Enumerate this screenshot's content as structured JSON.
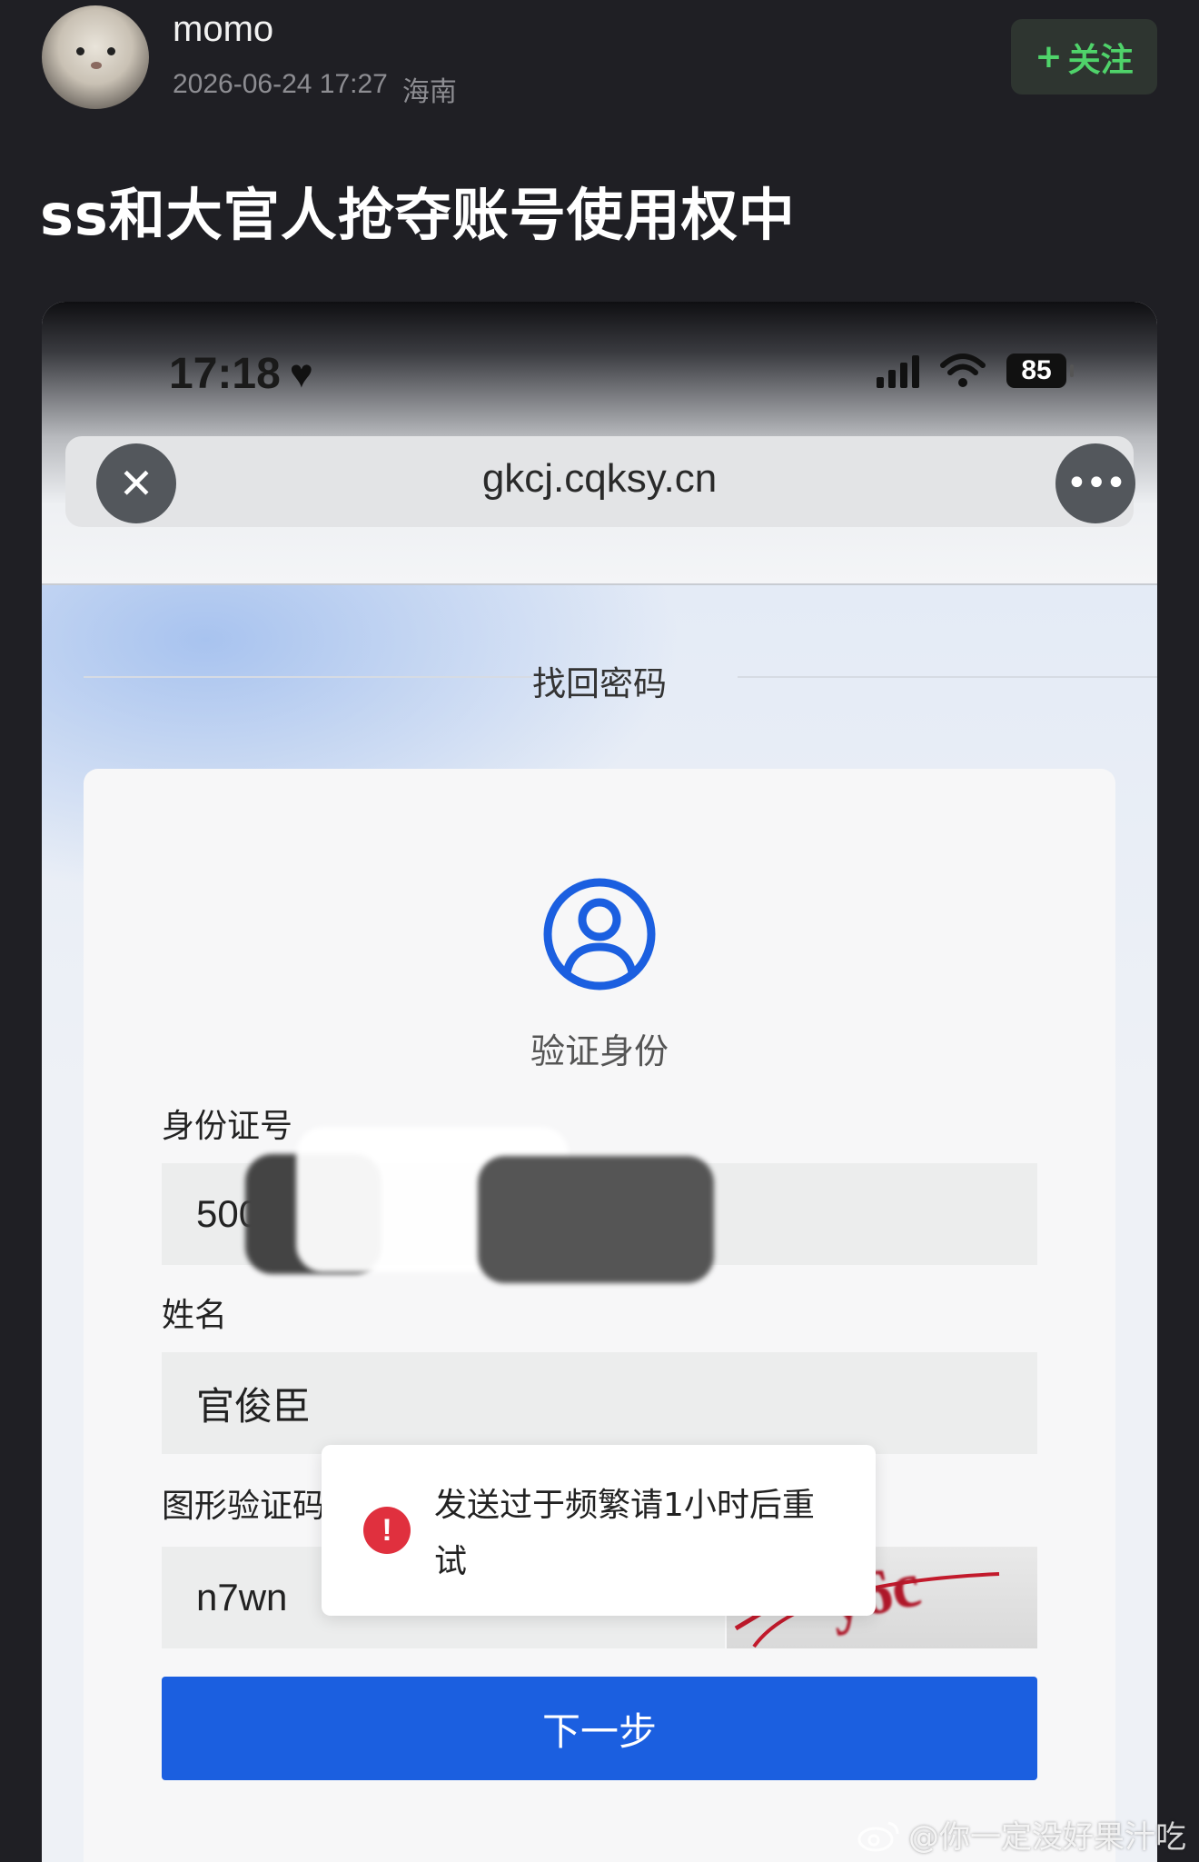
{
  "post": {
    "username": "momo",
    "timestamp": "2026-06-24 17:27",
    "location": "海南",
    "follow_label": "关注",
    "follow_icon": "plus-icon",
    "title": "ss和大官人抢夺账号使用权中"
  },
  "phone": {
    "status_time": "17:18",
    "battery": "85",
    "url": "gkcj.cqksy.cn",
    "close_icon": "close-icon",
    "more_icon": "more-icon"
  },
  "page": {
    "heading": "找回密码",
    "verify_label": "验证身份",
    "id_label": "身份证号",
    "id_value": "500",
    "name_label": "姓名",
    "name_value": "官俊臣",
    "captcha_label": "图形验证码",
    "captcha_value": "n7wn",
    "captcha_image_text": "y6c",
    "next_button": "下一步"
  },
  "toast": {
    "message": "发送过于频繁请1小时后重试",
    "icon": "warning-icon"
  },
  "watermark": {
    "text": "@你一定没好果汁吃"
  },
  "colors": {
    "accent_blue": "#1b5fe0",
    "follow_green": "#4fd36a",
    "error_red": "#e0303e",
    "background": "#1f1f24"
  }
}
